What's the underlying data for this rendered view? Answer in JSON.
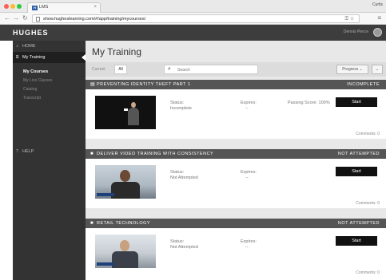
{
  "browser": {
    "tab_title": "LMS",
    "tab_favicon": "H",
    "profile": "Curtis",
    "url": "show.hugheslearning.com/#/app/training/mycourses/"
  },
  "header": {
    "logo": "HUGHES",
    "user_name": "Dennis Pierce"
  },
  "sidebar": {
    "home": "HOME",
    "my_training": "My Training",
    "sub_items": [
      "My Courses",
      "My Live Classes",
      "Catalog",
      "Transcript"
    ],
    "help": "HELP"
  },
  "main": {
    "title": "My Training",
    "filter_current": "Current",
    "filter_all": "All",
    "search_placeholder": "Search",
    "progress_label": "Progress",
    "sort_label": "⌄"
  },
  "courses": [
    {
      "type_icon": "document-icon",
      "title": "PREVENTING IDENTITY THEFT PART 1",
      "status_label": "INCOMPLETE",
      "status_caption": "Status:",
      "status_value": "Incomplete",
      "expires_caption": "Expires:",
      "expires_value": "--",
      "passing_score": "Passing Score: 100%",
      "action": "Start",
      "comments": "Comments: 0"
    },
    {
      "type_icon": "video-icon",
      "title": "DELIVER VIDEO TRAINING WITH CONSISTENCY",
      "status_label": "NOT ATTEMPTED",
      "status_caption": "Status:",
      "status_value": "Not Attempted",
      "expires_caption": "Expires:",
      "expires_value": "--",
      "action": "Start",
      "comments": "Comments: 0"
    },
    {
      "type_icon": "video-icon",
      "title": "RETAIL TECHNOLOGY",
      "status_label": "NOT ATTEMPTED",
      "status_caption": "Status:",
      "status_value": "Not Attempted",
      "expires_caption": "Expires:",
      "expires_value": "--",
      "action": "Start",
      "comments": "Comments: 0"
    }
  ],
  "colors": {
    "header_bg": "#3d3d3d",
    "sidebar_bg": "#333333",
    "card_header_bg": "#555555",
    "start_button_bg": "#111111"
  }
}
